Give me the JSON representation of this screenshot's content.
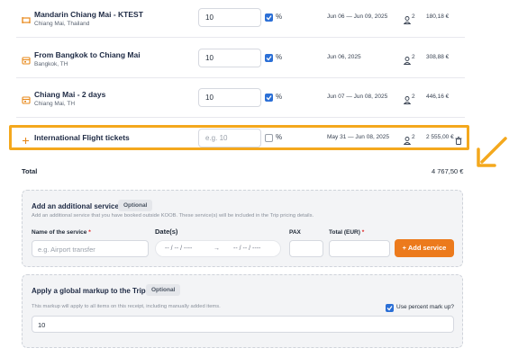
{
  "items": [
    {
      "title": "Mandarin Chiang Mai - KTEST",
      "subtitle": "Chiang Mai, Thailand",
      "icon": "hotel-icon",
      "markup": "10",
      "markup_checked": true,
      "percent": "%",
      "dates": "Jun 06 — Jun 09, 2025",
      "pax": "2",
      "price": "180,18 €"
    },
    {
      "title": "From Bangkok to Chiang Mai",
      "subtitle": "Bangkok, TH",
      "icon": "calendar-icon",
      "markup": "10",
      "markup_checked": true,
      "percent": "%",
      "dates": "Jun 06, 2025",
      "pax": "2",
      "price": "308,88 €"
    },
    {
      "title": "Chiang Mai - 2 days",
      "subtitle": "Chiang Mai, TH",
      "icon": "calendar-icon",
      "markup": "10",
      "markup_checked": true,
      "percent": "%",
      "dates": "Jun 07 — Jun 08, 2025",
      "pax": "2",
      "price": "446,16 €"
    },
    {
      "title": "International Flight tickets",
      "subtitle": "",
      "icon": "plus-icon",
      "markup_placeholder": "e.g. 10",
      "markup_checked": false,
      "percent": "%",
      "dates": "May 31 — Jun 08, 2025",
      "pax": "2",
      "price": "2 555,00 €"
    }
  ],
  "total": {
    "label": "Total",
    "value": "4 767,50 €"
  },
  "additional_service": {
    "title": "Add an additional service",
    "badge": "Optional",
    "description": "Add an additional service that you have booked outside KOOB. These service(s) will be included in the Trip pricing details.",
    "name_label": "Name of the service",
    "name_required": "*",
    "name_placeholder": "e.g. Airport transfer",
    "dates_label": "Date(s)",
    "date_from_placeholder": "-- / -- / ----",
    "date_arrow": "→",
    "date_to_placeholder": "-- / -- / ----",
    "pax_label": "PAX",
    "total_label": "Total (EUR)",
    "total_required": "*",
    "button": "+ Add service"
  },
  "global_markup": {
    "title": "Apply a global markup to the Trip",
    "badge": "Optional",
    "description": "This markup will apply to all items on this receipt, including manually added items.",
    "percent_label": "Use percent mark up?",
    "percent_checked": true,
    "value": "10"
  },
  "colors": {
    "accent": "#ec7a1c",
    "highlight": "#f4a81d",
    "check": "#2b6fd6"
  }
}
